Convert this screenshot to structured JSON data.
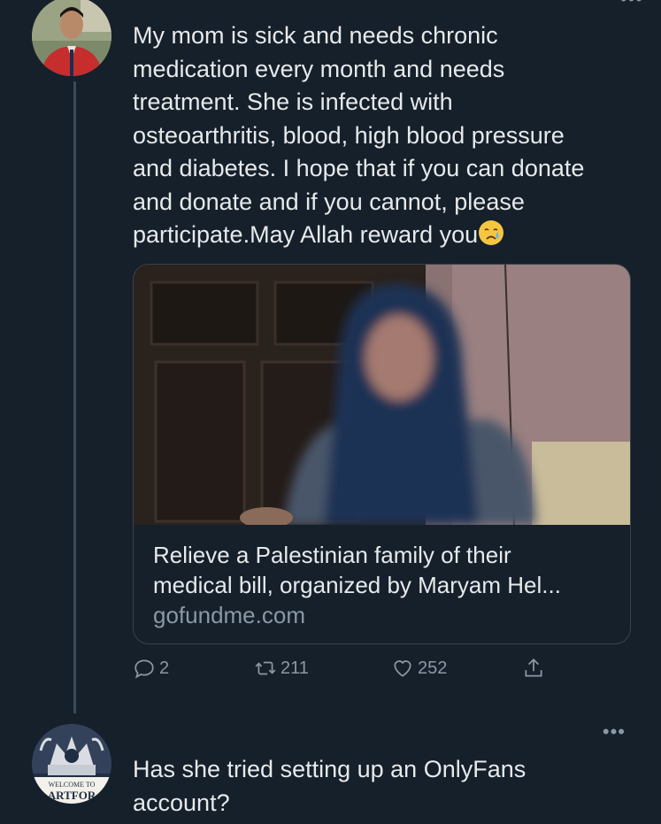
{
  "tweet": {
    "text_line_1": "My mom is sick and needs chronic",
    "text_line_2": "medication every month and needs",
    "text_line_3": "treatment. She is infected with",
    "text_line_4": "osteoarthritis, blood, high blood pressure",
    "text_line_5": "and diabetes. I hope that if you can donate",
    "text_line_6": "and donate and if you cannot, please",
    "text_line_7": "participate.May Allah reward you",
    "emoji": "crying-face-emoji"
  },
  "link_card": {
    "title_line_1": "Relieve a Palestinian family of their",
    "title_line_2": "medical bill, organized by Maryam Hel...",
    "domain": "gofundme.com"
  },
  "actions": {
    "replies": "2",
    "retweets": "211",
    "likes": "252"
  },
  "reply": {
    "avatar_text_1": "WELCOME TO",
    "avatar_text_2": "ARTFOR",
    "text_line_1": "Has she tried setting up an OnlyFans",
    "text_line_2": "account?"
  },
  "icons": {
    "reply": "reply-icon",
    "retweet": "retweet-icon",
    "like": "heart-icon",
    "share": "share-icon",
    "more": "more-icon"
  },
  "colors": {
    "background": "#15202b",
    "text": "#e7e9ea",
    "muted": "#8b98a5",
    "border": "#38444d"
  }
}
